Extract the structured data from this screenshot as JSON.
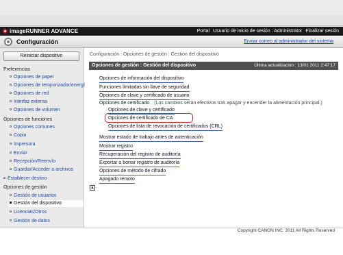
{
  "browser": {
    "dropdown_glyph": "▼"
  },
  "header": {
    "brand": "imageRUNNER ADVANCE",
    "portal": "Portal",
    "login_user": "Usuario de inicio de sesión : Administrator",
    "logout": "Finalizar sesión"
  },
  "subheader": {
    "title": "Configuración",
    "email_admin": "Enviar correo al administrador del sistema"
  },
  "sidebar": {
    "restart_label": "Reiniciar dispositivo",
    "preferences_heading": "Preferencias",
    "preferences": [
      "Opciones de papel",
      "Opciones de temporizador/energía",
      "Opciones de red",
      "Interfaz externa",
      "Opciones de volumen"
    ],
    "functions_heading": "Opciones de funciones",
    "functions": [
      "Opciones comunes",
      "Copia",
      "Impresora",
      "Enviar",
      "Recepción/Reenvío",
      "Guardar/Acceder a archivos"
    ],
    "set_destination": "Establecer destino",
    "management_heading": "Opciones de gestión",
    "management": [
      "Gestión de usuarios",
      "Gestión del dispositivo",
      "Licencias/Otros",
      "Gestión de datos"
    ]
  },
  "content": {
    "breadcrumb": "Configuración : Opciones de gestión : Gestión del dispositivo",
    "section_title": "Opciones de gestión : Gestión del dispositivo",
    "last_updated": "Última actualización : 13/01 2011 2:47:17",
    "links": {
      "device_info": "Opciones de información del dispositivo",
      "limited_functions": "Funciones limitadas sin llave de seguridad",
      "user_key_cert": "Opciones de clave y certificado de usuario",
      "cert_options": "Opciones de certificado",
      "cert_note": "(Los cambios serán efectivos tras apagar y encender la alimentación principal.)",
      "key_cert": "Opciones de clave y certificado",
      "ca_cert": "Opciones de certificado de CA",
      "crl": "Opciones de lista de revocación de certificados (CRL)",
      "job_status": "Mostrar estado de trabajo antes de autenticación",
      "show_log": "Mostrar registro",
      "audit_restore": "Recuperación del registro de auditoría",
      "audit_export": "Exportar o borrar registro de auditoría",
      "encryption": "Opciones de método de cifrado",
      "remote_off": "Apagado remoto"
    },
    "top_glyph": "▲"
  },
  "footer": {
    "copyright": "Copyright CANON INC. 2011 All Rights Reserved"
  },
  "colors": {
    "header_bg": "#1a1a1a",
    "section_bar": "#4f4f4f",
    "link": "#1f4aa0",
    "highlight": "#d51f1f"
  }
}
